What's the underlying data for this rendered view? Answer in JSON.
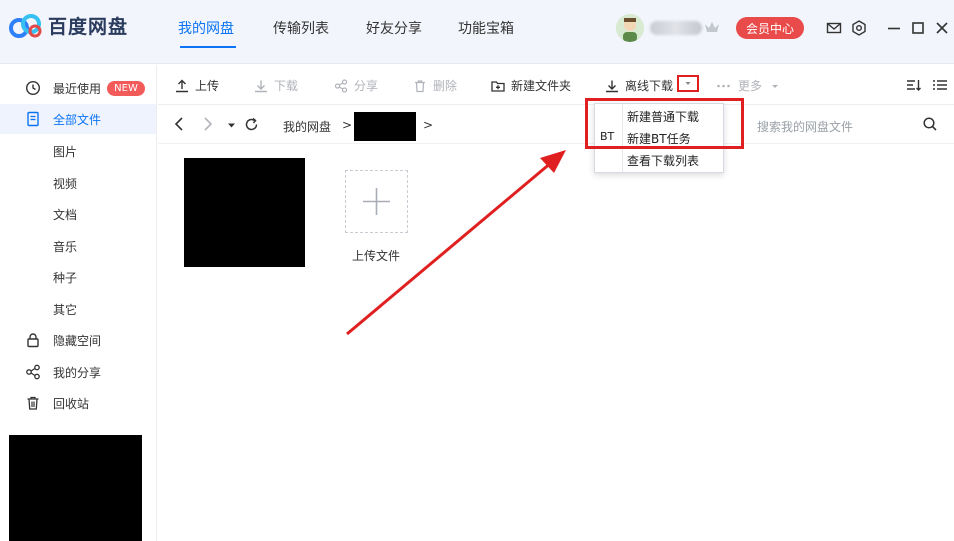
{
  "app": {
    "name": "百度网盘"
  },
  "tabs": [
    {
      "label": "我的网盘",
      "active": true
    },
    {
      "label": "传输列表"
    },
    {
      "label": "好友分享"
    },
    {
      "label": "功能宝箱"
    }
  ],
  "header": {
    "vip_label": "会员中心"
  },
  "sidebar": {
    "items": [
      {
        "label": "最近使用",
        "icon": "clock-icon",
        "badge": "NEW"
      },
      {
        "label": "全部文件",
        "icon": "document-icon",
        "active": true
      },
      {
        "label": "图片"
      },
      {
        "label": "视频"
      },
      {
        "label": "文档"
      },
      {
        "label": "音乐"
      },
      {
        "label": "种子"
      },
      {
        "label": "其它"
      },
      {
        "label": "隐藏空间",
        "icon": "lock-icon"
      },
      {
        "label": "我的分享",
        "icon": "share-icon"
      },
      {
        "label": "回收站",
        "icon": "trash-icon"
      }
    ]
  },
  "toolbar": {
    "upload": "上传",
    "download": "下载",
    "share": "分享",
    "delete": "删除",
    "new_folder": "新建文件夹",
    "offline_download": "离线下载",
    "more": "更多"
  },
  "path": {
    "root": "我的网盘",
    "sep1": ">",
    "sep2": ">",
    "search_placeholder": "搜索我的网盘文件"
  },
  "content": {
    "upload_label": "上传文件"
  },
  "menu": {
    "items": [
      {
        "label": "新建普通下载"
      },
      {
        "label": "新建BT任务",
        "icon_text": "BT"
      },
      {
        "label": "查看下载列表"
      }
    ]
  },
  "colors": {
    "accent": "#0c74f4",
    "vip": "#e94a4a",
    "annotation": "#e02020"
  }
}
